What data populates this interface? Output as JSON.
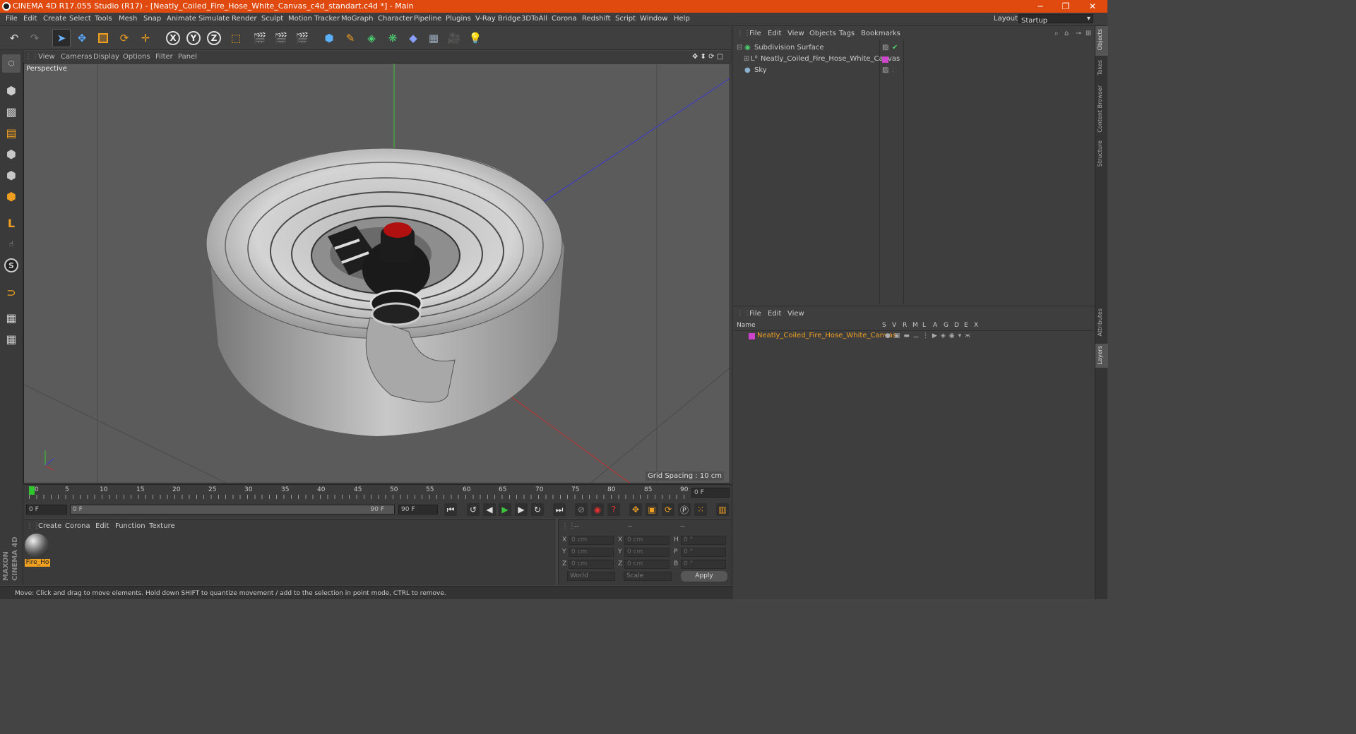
{
  "window": {
    "title": "CINEMA 4D R17.055 Studio (R17) - [Neatly_Coiled_Fire_Hose_White_Canvas_c4d_standart.c4d *] - Main",
    "minimize": "─",
    "maximize": "❐",
    "close": "✕"
  },
  "menu": [
    "File",
    "Edit",
    "Create",
    "Select",
    "Tools",
    "Mesh",
    "Snap",
    "Animate",
    "Simulate",
    "Render",
    "Sculpt",
    "Motion Tracker",
    "MoGraph",
    "Character",
    "Pipeline",
    "Plugins",
    "V-Ray Bridge",
    "3DToAll",
    "Corona",
    "Redshift",
    "Script",
    "Window",
    "Help"
  ],
  "layout": {
    "label": "Layout:",
    "value": "Startup"
  },
  "toolbar": {
    "x": "X",
    "y": "Y",
    "z": "Z"
  },
  "viewport": {
    "menu": [
      "View",
      "Cameras",
      "Display",
      "Options",
      "Filter",
      "Panel"
    ],
    "label": "Perspective",
    "grid_spacing": "Grid Spacing : 10 cm"
  },
  "timeline": {
    "ticks": [
      "0",
      "5",
      "10",
      "15",
      "20",
      "25",
      "30",
      "35",
      "40",
      "45",
      "50",
      "55",
      "60",
      "65",
      "70",
      "75",
      "80",
      "85",
      "90"
    ],
    "current_frame": "0 F",
    "start": "0 F",
    "slider_start": "0 F",
    "slider_end": "90 F",
    "end": "90 F"
  },
  "material": {
    "menu": [
      "Create",
      "Corona",
      "Edit",
      "Function",
      "Texture"
    ],
    "items": [
      {
        "name": "Fire_Ho"
      }
    ]
  },
  "coords": {
    "header": [
      "--",
      "--",
      "--"
    ],
    "rows": [
      {
        "a": "X",
        "av": "0 cm",
        "b": "X",
        "bv": "0 cm",
        "c": "H",
        "cv": "0 °"
      },
      {
        "a": "Y",
        "av": "0 cm",
        "b": "Y",
        "bv": "0 cm",
        "c": "P",
        "cv": "0 °"
      },
      {
        "a": "Z",
        "av": "0 cm",
        "b": "Z",
        "bv": "0 cm",
        "c": "B",
        "cv": "0 °"
      }
    ],
    "world": "World",
    "scale": "Scale",
    "apply": "Apply"
  },
  "status": "Move: Click and drag to move elements. Hold down SHIFT to quantize movement / add to the selection in point mode, CTRL to remove.",
  "objects": {
    "menu": [
      "File",
      "Edit",
      "View",
      "Objects",
      "Tags",
      "Bookmarks"
    ],
    "items": [
      {
        "name": "Subdivision Surface"
      },
      {
        "name": "Neatly_Coiled_Fire_Hose_White_Canvas"
      },
      {
        "name": "Sky"
      }
    ]
  },
  "layers": {
    "menu": [
      "File",
      "Edit",
      "View"
    ],
    "columns": {
      "name": "Name",
      "flags": [
        "S",
        "V",
        "R",
        "M",
        "L",
        "A",
        "G",
        "D",
        "E",
        "X"
      ]
    },
    "items": [
      {
        "name": "Neatly_Coiled_Fire_Hose_White_Canvas",
        "color": "#cc44cc"
      }
    ]
  },
  "right_tabs": [
    "Objects",
    "Takes",
    "Content Browser",
    "Structure",
    "Attributes",
    "Layers"
  ],
  "brand": {
    "line1": "MAXON",
    "line2": "CINEMA 4D"
  }
}
